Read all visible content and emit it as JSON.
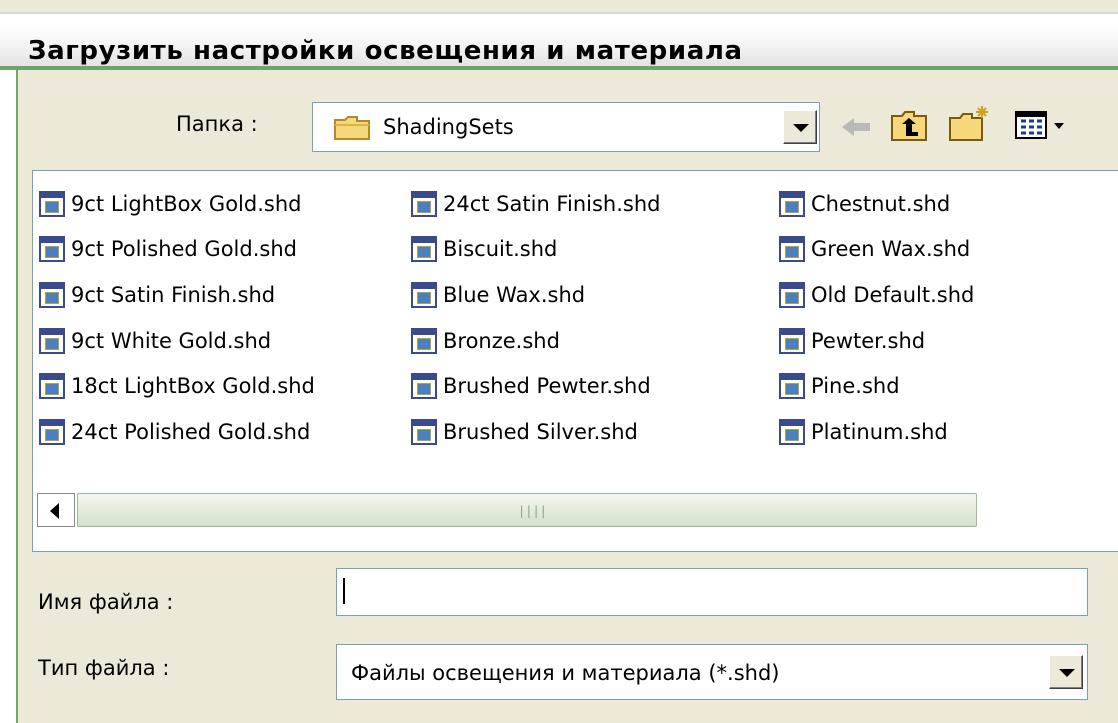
{
  "window": {
    "title": "Загрузить настройки освещения и материала"
  },
  "folder": {
    "label": "Папка :",
    "value": "ShadingSets"
  },
  "toolbar": {
    "icons": [
      "back-arrow-icon",
      "up-folder-icon",
      "new-folder-icon",
      "view-menu-icon"
    ]
  },
  "files": {
    "columns": [
      [
        "9ct LightBox Gold.shd",
        "9ct Polished Gold.shd",
        "9ct Satin Finish.shd",
        "9ct White Gold.shd",
        "18ct LightBox Gold.shd",
        "24ct Polished Gold.shd"
      ],
      [
        "24ct Satin Finish.shd",
        "Biscuit.shd",
        "Blue Wax.shd",
        "Bronze.shd",
        "Brushed Pewter.shd",
        "Brushed Silver.shd"
      ],
      [
        "Chestnut.shd",
        "Green Wax.shd",
        "Old Default.shd",
        "Pewter.shd",
        "Pine.shd",
        "Platinum.shd"
      ]
    ]
  },
  "filename": {
    "label": "Имя файла :",
    "value": ""
  },
  "filetype": {
    "label": "Тип файла :",
    "value": "Файлы освещения и материала (*.shd)"
  },
  "colors": {
    "accent_frame": "#6fa569",
    "input_border": "#7f9db9",
    "dialog_bg": "#ece9d8"
  }
}
